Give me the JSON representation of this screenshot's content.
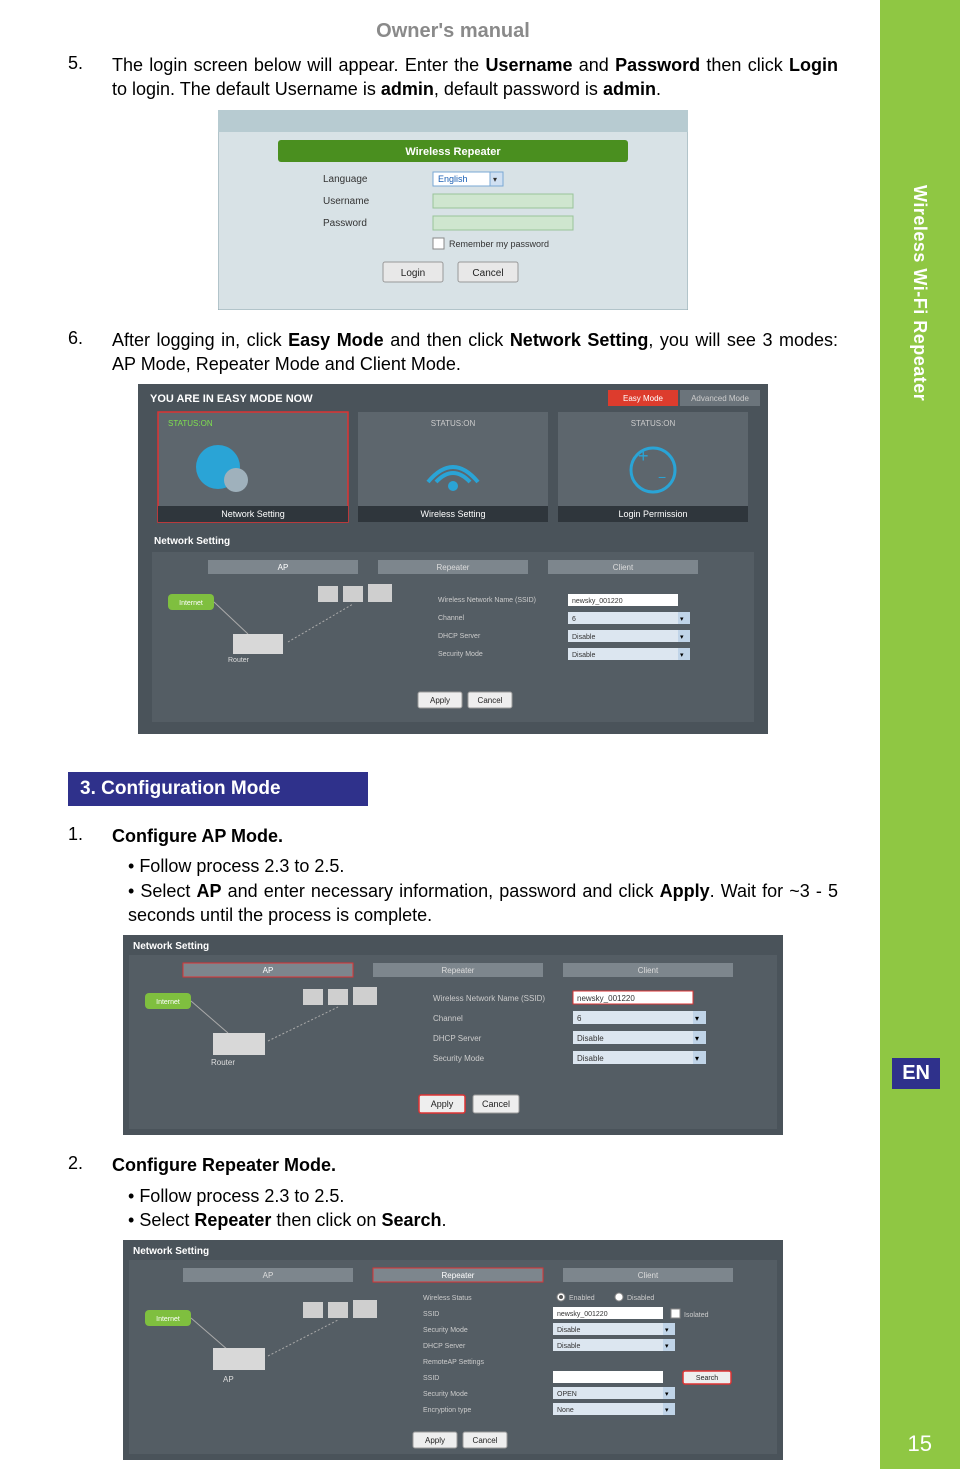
{
  "header": "Owner's manual",
  "sidebar": {
    "sideLabel": "Wireless Wi-Fi Repeater",
    "lang": "EN",
    "pageNum": "15"
  },
  "step5": {
    "num": "5.",
    "text_a": "The login screen below will appear. Enter the ",
    "bold1": "Username",
    "text_b": " and ",
    "bold2": "Password",
    "text_c": " then click ",
    "bold3": "Login",
    "text_d": " to login. The default Username is ",
    "bold4": "admin",
    "text_e": ", default password is ",
    "bold5": "admin",
    "text_f": "."
  },
  "loginMock": {
    "title": "Wireless Repeater",
    "lblLang": "Language",
    "lblUser": "Username",
    "lblPass": "Password",
    "langVal": "English",
    "remember": "Remember my password",
    "btnLogin": "Login",
    "btnCancel": "Cancel"
  },
  "step6": {
    "num": "6.",
    "text_a": "After logging in, click ",
    "bold1": "Easy Mode",
    "text_b": " and then click ",
    "bold2": "Network Setting",
    "text_c": ", you will see 3 modes: AP Mode, Repeater Mode and Client Mode."
  },
  "easyMock": {
    "banner": "YOU ARE IN EASY MODE NOW",
    "statusOn": "STATUS:ON",
    "tabEasy": "Easy Mode",
    "tabAdv": "Advanced Mode",
    "card1": "Network Setting",
    "card2": "Wireless Setting",
    "card3": "Login Permission",
    "nsTitle": "Network Setting",
    "tabAP": "AP",
    "tabRep": "Repeater",
    "tabCli": "Client",
    "fldSSID": "Wireless Network Name (SSID)",
    "fldChan": "Channel",
    "fldDHCP": "DHCP Server",
    "fldSec": "Security Mode",
    "valSSID": "newsky_001220",
    "valChan": "6",
    "valDis": "Disable",
    "btnApply": "Apply",
    "btnCancel": "Cancel",
    "internet": "Internet",
    "router": "Router"
  },
  "secHead": "3. Configuration Mode",
  "conf1": {
    "num": "1.",
    "title": "Configure AP Mode.",
    "b1": "Follow process 2.3 to 2.5.",
    "b2a": "Select ",
    "b2bold1": "AP",
    "b2b": " and enter necessary information, password and click ",
    "b2bold2": "Apply",
    "b2c": ". Wait for ~3 - 5 seconds until the process is complete."
  },
  "nsMock1": {
    "title": "Network Setting",
    "tabAP": "AP",
    "tabRep": "Repeater",
    "tabCli": "Client",
    "fldSSID": "Wireless Network Name (SSID)",
    "fldChan": "Channel",
    "fldDHCP": "DHCP Server",
    "fldSec": "Security Mode",
    "valSSID": "newsky_001220",
    "valChan": "6",
    "valDis": "Disable",
    "btnApply": "Apply",
    "btnCancel": "Cancel",
    "internet": "Internet",
    "router": "Router"
  },
  "conf2": {
    "num": "2.",
    "title": "Configure Repeater Mode.",
    "b1": "Follow process 2.3 to 2.5.",
    "b2a": "Select ",
    "b2bold1": "Repeater",
    "b2b": " then click on ",
    "b2bold2": "Search",
    "b2c": "."
  },
  "nsMock2": {
    "title": "Network Setting",
    "tabAP": "AP",
    "tabRep": "Repeater",
    "tabCli": "Client",
    "fldWS": "Wireless Status",
    "fldSSID": "SSID",
    "fldSec": "Security Mode",
    "fldDHCP": "DHCP Server",
    "fldRAP": "RemoteAP Settings",
    "fldSSID2": "SSID",
    "fldSec2": "Security Mode",
    "fldEnc": "Encryption type",
    "optEn": "Enabled",
    "optDis": "Disabled",
    "valSSID": "newsky_001220",
    "valDis": "Disable",
    "valOpen": "OPEN",
    "valNone": "None",
    "chkIso": "Isolated",
    "btnSearch": "Search",
    "btnApply": "Apply",
    "btnCancel": "Cancel",
    "internet": "Internet",
    "ap": "AP"
  }
}
